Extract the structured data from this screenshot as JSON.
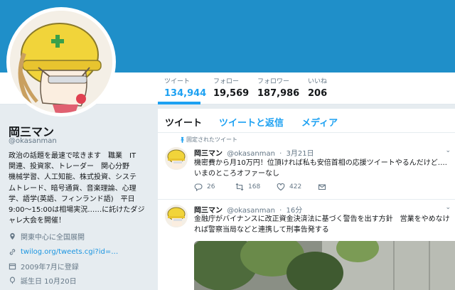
{
  "colors": {
    "banner": "#1f8fc9",
    "accent": "#1da1f2",
    "link": "#1b95e0",
    "muted": "#657786",
    "text": "#14171a"
  },
  "stats": [
    {
      "label": "ツイート",
      "value": "134,944"
    },
    {
      "label": "フォロー",
      "value": "19,569"
    },
    {
      "label": "フォロワー",
      "value": "187,986"
    },
    {
      "label": "いいね",
      "value": "206"
    }
  ],
  "profile": {
    "name": "岡三マン",
    "handle": "@okasanman",
    "bio": "政治の話題を最速で呟きます　職業　IT\n関連、投資家、トレーダー　関心分野\n機械学習、人工知能、株式投資、システ\nムトレード、暗号通貨、音楽理論、心理\n学、語学(英語、フィンランド語)　平日\n9:00〜15:00は相場実況……に託けたダジ\nャレ大会を開催！",
    "location": "関東中心に全国展開",
    "website": "twilog.org/tweets.cgi?id=…",
    "joined": "2009年7月に登録",
    "birthday": "誕生日 10月20日",
    "avatar_icon": "hardhat-character-avatar"
  },
  "tabs": [
    "ツイート",
    "ツイートと返信",
    "メディア"
  ],
  "tweets": [
    {
      "pinned_label": "固定されたツイート",
      "name": "岡三マン",
      "handle": "@okasanman",
      "dot": "·",
      "time": "3月21日",
      "text": "機密費から月10万円！位頂ければ私も安倍首相の応援ツイートやるんだけど….\nいまのところオファーなし",
      "replies": "26",
      "retweets": "168",
      "likes": "422"
    },
    {
      "name": "岡三マン",
      "handle": "@okasanman",
      "dot": "·",
      "time": "16分",
      "text": "金融庁がバイナンスに改正資金決済法に基づく警告を出す方針　営業をやめなけ\nれば警察当局などと連携して刑事告発する"
    }
  ]
}
